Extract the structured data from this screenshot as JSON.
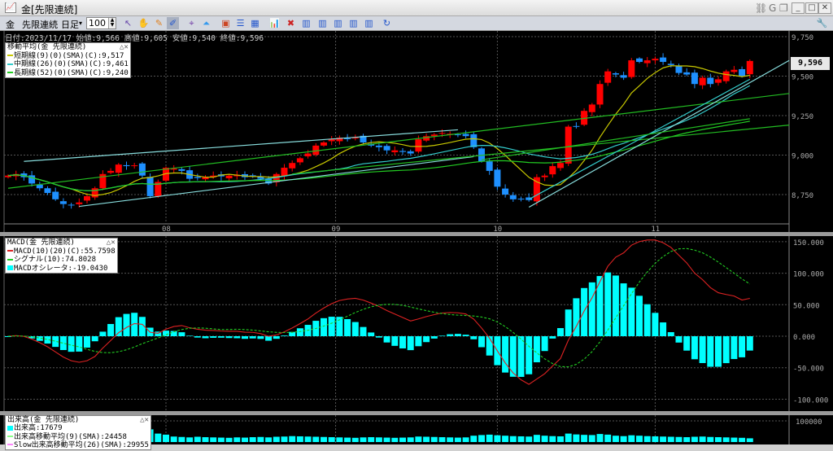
{
  "window": {
    "title": "金[先限連続]",
    "app_icon": "chart-icon"
  },
  "toolbar": {
    "symbol": "金",
    "contract": "先限連続",
    "period": "日足",
    "count": "100"
  },
  "info_line": "日付:2023/11/17 始値:9,566 高値:9,605 安値:9,540 終値:9,596",
  "price_panel": {
    "legend_title": "移動平均(金 先限連続)",
    "legend": [
      {
        "label": "短期線(9)(0)(SMA)(C):9,517",
        "color": "#c8c800"
      },
      {
        "label": "中期線(26)(0)(SMA)(C):9,461",
        "color": "#33cccc"
      },
      {
        "label": "長期線(52)(0)(SMA)(C):9,240",
        "color": "#22cc22"
      }
    ],
    "current_price": "9,596",
    "y_ticks": [
      {
        "v": 9750,
        "t": "9,750"
      },
      {
        "v": 9500,
        "t": "9,500"
      },
      {
        "v": 9250,
        "t": "9,250"
      },
      {
        "v": 9000,
        "t": "9,000"
      },
      {
        "v": 8750,
        "t": "8,750"
      }
    ],
    "x_ticks": [
      {
        "i": 20,
        "t": "08"
      },
      {
        "i": 41.5,
        "t": "09"
      },
      {
        "i": 62,
        "t": "10"
      },
      {
        "i": 82,
        "t": "11"
      }
    ]
  },
  "macd_panel": {
    "legend_title": "MACD(金 先限連続)",
    "legend": [
      {
        "label": "MACD(10)(20)(C):55.7598",
        "color": "#dd2222"
      },
      {
        "label": "シグナル(10):74.8028",
        "color": "#22cc22"
      },
      {
        "label": "MACDオシレータ:-19.0430",
        "color": "#00ffff"
      }
    ],
    "y_ticks": [
      {
        "v": 150,
        "t": "150.000"
      },
      {
        "v": 100,
        "t": "100.000"
      },
      {
        "v": 50,
        "t": "50.000"
      },
      {
        "v": 0,
        "t": "0.000"
      },
      {
        "v": -50,
        "t": "-50.000"
      },
      {
        "v": -100,
        "t": "-100.000"
      }
    ]
  },
  "volume_panel": {
    "legend_title": "出来高(金 先限連続)",
    "legend": [
      {
        "label": "出来高:17679",
        "color": "#00ffff"
      },
      {
        "label": "出来高移動平均(9)(SMA):24458",
        "color": "#88ff88"
      },
      {
        "label": "Slow出来高移動平均(26)(SMA):29955",
        "color": "#ff88ff"
      }
    ],
    "y_ticks": [
      {
        "v": 100000,
        "t": "100000"
      }
    ]
  },
  "colors": {
    "up": "#ff0000",
    "down": "#1e90ff",
    "sma_short": "#c8c800",
    "sma_mid": "#33cccc",
    "sma_long": "#22cc22",
    "trend_light": "#88dddd",
    "trend_green": "#22bb22"
  },
  "chart_data": {
    "type": "candlestick",
    "closes": [
      8870,
      8880,
      8860,
      8820,
      8790,
      8760,
      8720,
      8690,
      8685,
      8700,
      8740,
      8790,
      8880,
      8900,
      8940,
      8930,
      8935,
      8870,
      8740,
      8830,
      8920,
      8915,
      8900,
      8850,
      8855,
      8860,
      8870,
      8865,
      8870,
      8875,
      8860,
      8870,
      8850,
      8820,
      8880,
      8920,
      8950,
      8980,
      9010,
      9060,
      9080,
      9100,
      9110,
      9105,
      9110,
      9080,
      9060,
      9050,
      9030,
      9030,
      9020,
      9010,
      9100,
      9120,
      9130,
      9140,
      9135,
      9130,
      9120,
      9050,
      8960,
      8900,
      8800,
      8750,
      8720,
      8720,
      8715,
      8860,
      8870,
      8930,
      8950,
      9180,
      9180,
      9280,
      9320,
      9450,
      9530,
      9510,
      9490,
      9600,
      9590,
      9600,
      9610,
      9590,
      9570,
      9520,
      9510,
      9450,
      9490,
      9450,
      9480,
      9530,
      9540,
      9500,
      9596
    ],
    "volumes": [
      22000,
      20000,
      21000,
      23000,
      22000,
      24000,
      25000,
      26000,
      24000,
      22000,
      21000,
      20000,
      24000,
      26000,
      25000,
      23000,
      22000,
      30000,
      60000,
      40000,
      35000,
      26000,
      24000,
      22000,
      25000,
      23000,
      22000,
      21000,
      20000,
      22000,
      21000,
      23000,
      24000,
      22000,
      25000,
      26000,
      28000,
      27000,
      26000,
      25000,
      24000,
      23000,
      22000,
      21000,
      20000,
      22000,
      23000,
      22000,
      21000,
      20000,
      21000,
      22000,
      26000,
      25000,
      24000,
      23000,
      22000,
      21000,
      22000,
      30000,
      33000,
      35000,
      32000,
      30000,
      28000,
      27000,
      26000,
      34000,
      30000,
      28000,
      27000,
      40000,
      36000,
      34000,
      33000,
      38000,
      35000,
      30000,
      28000,
      32000,
      30000,
      28000,
      27000,
      26000,
      25000,
      24000,
      23000,
      25000,
      26000,
      24000,
      23000,
      22000,
      21000,
      20000,
      17679
    ],
    "trend_lines": [
      {
        "a": [
          2,
          8960
        ],
        "b": [
          57,
          9160
        ],
        "c": "trend_light"
      },
      {
        "a": [
          9,
          8675
        ],
        "b": [
          59,
          8990
        ],
        "c": "trend_light"
      },
      {
        "a": [
          0,
          8790
        ],
        "b": [
          99,
          9390
        ],
        "c": "trend_green"
      },
      {
        "a": [
          36,
          8880
        ],
        "b": [
          99,
          9190
        ],
        "c": "trend_green"
      },
      {
        "a": [
          66,
          8670
        ],
        "b": [
          99,
          9600
        ],
        "c": "trend_light"
      },
      {
        "a": [
          66,
          8720
        ],
        "b": [
          94,
          9480
        ],
        "c": "sma_mid"
      },
      {
        "a": [
          60,
          8970
        ],
        "b": [
          94,
          9230
        ],
        "c": "trend_green"
      }
    ],
    "title": "金[先限連続] 日足"
  }
}
